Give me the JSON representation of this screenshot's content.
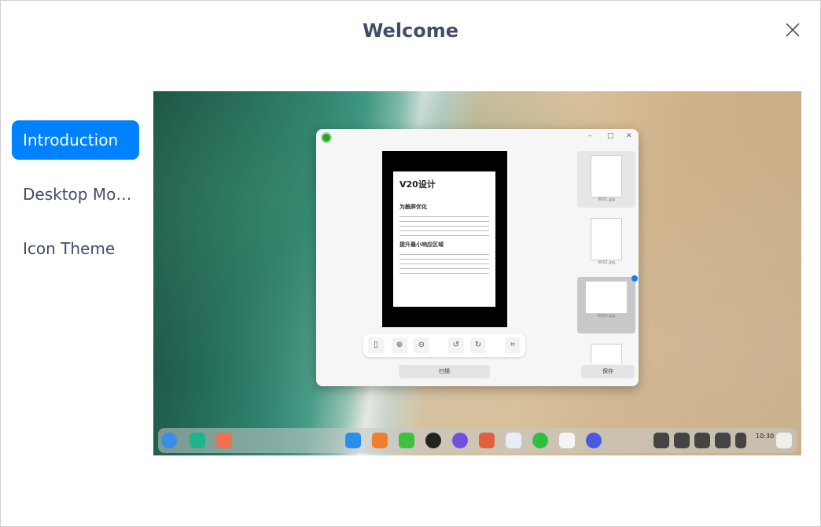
{
  "header": {
    "title": "Welcome"
  },
  "sidebar": {
    "items": [
      {
        "label": "Introduction",
        "active": true
      },
      {
        "label": "Desktop Mo…"
      },
      {
        "label": "Icon Theme"
      }
    ]
  },
  "preview": {
    "window": {
      "doc_title": "V20设计",
      "heading1": "为触屏优化",
      "heading2": "提升最小响应区域",
      "scan_button": "扫描",
      "save_button": "保存",
      "thumbnails": [
        "0001.jpg",
        "0002.jpg",
        "0003.jpg"
      ]
    },
    "dock": {
      "clock": "10:30"
    }
  },
  "colors": {
    "accent": "#0081ff",
    "text": "#414d68"
  }
}
